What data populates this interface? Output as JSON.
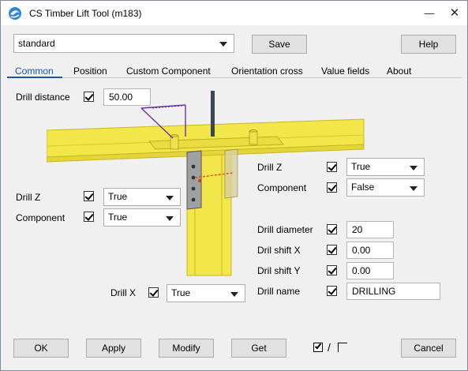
{
  "window": {
    "title": "CS Timber Lift Tool (m183)",
    "minimize_glyph": "—",
    "close_glyph": "✕"
  },
  "top": {
    "preset_value": "standard",
    "save_label": "Save",
    "help_label": "Help"
  },
  "tabs": [
    {
      "label": "Common",
      "active": true
    },
    {
      "label": "Position",
      "active": false
    },
    {
      "label": "Custom Component",
      "active": false
    },
    {
      "label": "Orientation cross",
      "active": false
    },
    {
      "label": "Value fields",
      "active": false
    },
    {
      "label": "About",
      "active": false
    }
  ],
  "left": {
    "drill_distance_label": "Drill distance",
    "drill_distance_value": "50.00",
    "drill_z_label": "Drill Z",
    "drill_z_value": "True",
    "component_label": "Component",
    "component_value": "True"
  },
  "bottom_center": {
    "drill_x_label": "Drill X",
    "drill_x_value": "True"
  },
  "right": {
    "drill_z_label": "Drill Z",
    "drill_z_value": "True",
    "component_label": "Component",
    "component_value": "False",
    "drill_diameter_label": "Drill diameter",
    "drill_diameter_value": "20",
    "shift_x_label": "Dril shift X",
    "shift_x_value": "0.00",
    "shift_y_label": "Dril shift Y",
    "shift_y_value": "0.00",
    "drill_name_label": "Drill name",
    "drill_name_value": "DRILLING"
  },
  "footer": {
    "ok_label": "OK",
    "apply_label": "Apply",
    "modify_label": "Modify",
    "get_label": "Get",
    "toggle_separator": "/",
    "cancel_label": "Cancel"
  },
  "colors": {
    "accent": "#1a56a8",
    "timber": "#f2e64a",
    "timber_edge": "#c8b820"
  }
}
